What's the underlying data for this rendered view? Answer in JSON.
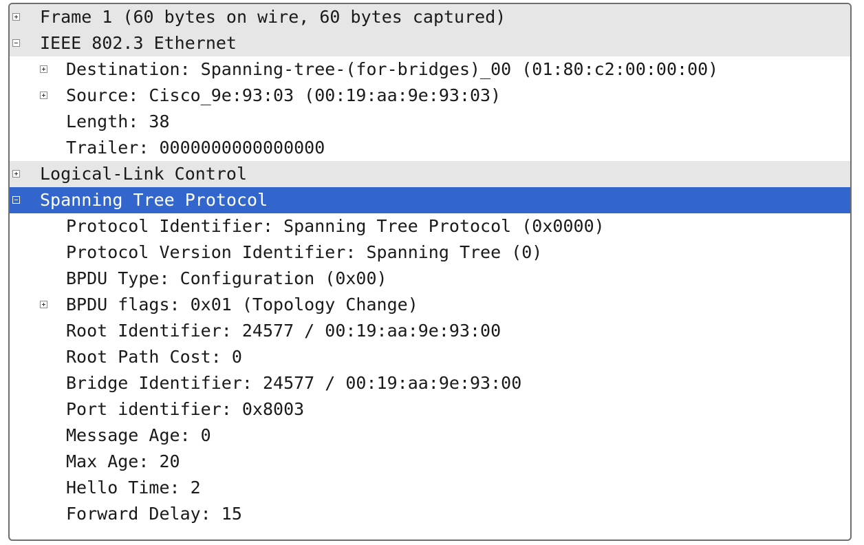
{
  "colors": {
    "selection": "#3366cc",
    "section_band": "#e6e6e6",
    "border": "#6e6e6e"
  },
  "tree": {
    "frame": {
      "label": "Frame 1 (60 bytes on wire, 60 bytes captured)",
      "icon": "expand-plus-icon"
    },
    "ethernet": {
      "label": "IEEE 802.3 Ethernet",
      "icon": "collapse-minus-icon",
      "destination": "Destination: Spanning-tree-(for-bridges)_00 (01:80:c2:00:00:00)",
      "source": "Source: Cisco_9e:93:03 (00:19:aa:9e:93:03)",
      "length": "Length: 38",
      "trailer": "Trailer: 0000000000000000"
    },
    "llc": {
      "label": "Logical-Link Control",
      "icon": "expand-plus-icon"
    },
    "stp": {
      "label": "Spanning Tree Protocol",
      "icon": "collapse-minus-icon",
      "protocol_identifier": "Protocol Identifier: Spanning Tree Protocol (0x0000)",
      "protocol_version": "Protocol Version Identifier: Spanning Tree (0)",
      "bpdu_type": "BPDU Type: Configuration (0x00)",
      "bpdu_flags": "BPDU flags: 0x01 (Topology Change)",
      "root_identifier": "Root Identifier: 24577 / 00:19:aa:9e:93:00",
      "root_path_cost": "Root Path Cost: 0",
      "bridge_identifier": "Bridge Identifier: 24577 / 00:19:aa:9e:93:00",
      "port_identifier": "Port identifier: 0x8003",
      "message_age": "Message Age: 0",
      "max_age": "Max Age: 20",
      "hello_time": "Hello Time: 2",
      "forward_delay": "Forward Delay: 15"
    }
  }
}
